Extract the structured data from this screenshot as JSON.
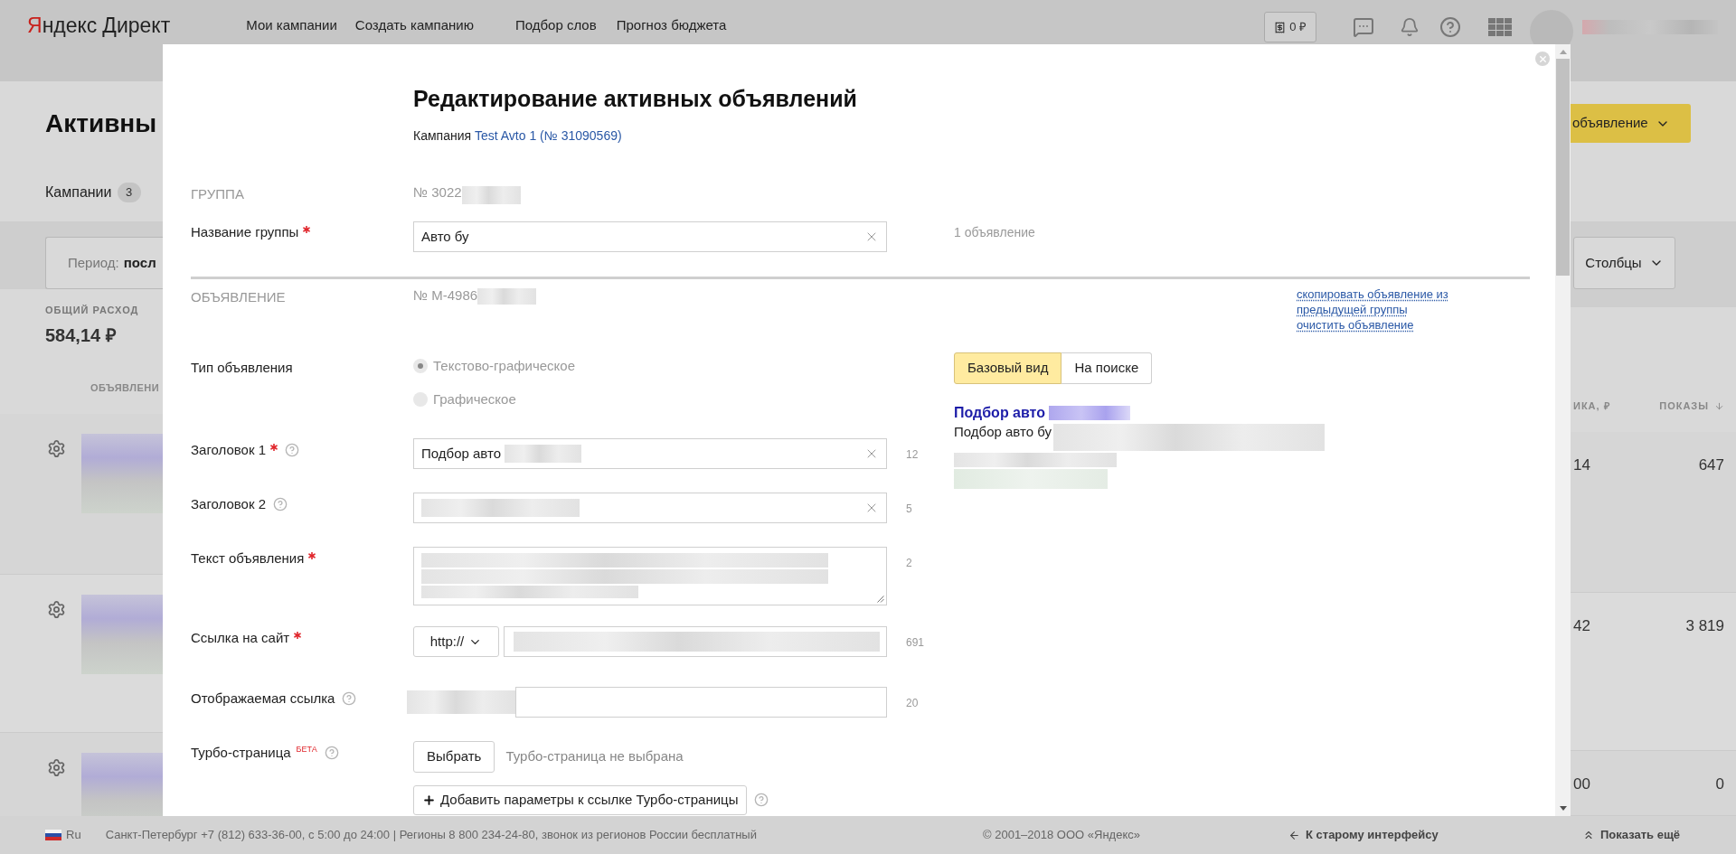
{
  "header": {
    "logo": {
      "brand": "Яндекс",
      "product": "Директ"
    },
    "nav": [
      {
        "label": "Мои кампании"
      },
      {
        "label": "Создать кампанию"
      },
      {
        "label": "Подбор слов"
      },
      {
        "label": "Прогноз бюджета"
      }
    ],
    "balance": "0 ₽",
    "user_redacted": true
  },
  "page": {
    "title": "Активны",
    "tab": {
      "label": "Кампании",
      "count": "3"
    },
    "period": {
      "label": "Период:",
      "value": "посл"
    },
    "total": {
      "label": "ОБЩИЙ РАСХОД",
      "value": "584,14 ₽"
    },
    "create_button": "объявление",
    "columns_button": "Столбцы",
    "table": {
      "columns": [
        {
          "label": "ОБЪЯВЛЕНИ",
          "sorted": false
        },
        {
          "label": "ИКА, ₽",
          "sorted": false
        },
        {
          "label": "ПОКАЗЫ",
          "sorted": true
        }
      ],
      "rows": [
        {
          "cost": "14",
          "shows": "647",
          "redacted": true
        },
        {
          "cost": "42",
          "shows": "3 819",
          "redacted": true
        },
        {
          "cost": "00",
          "shows": "0",
          "redacted": true
        }
      ]
    }
  },
  "modal": {
    "title": "Редактирование активных объявлений",
    "campaign_label": "Кампания",
    "campaign_link": "Test Avto 1 (№ 31090569)",
    "group": {
      "section": "ГРУППА",
      "number": "№ 3022",
      "number_redacted": true,
      "name_label": "Название группы",
      "name_required": true,
      "name_value": "Авто бу",
      "ads_count": "1 объявление"
    },
    "ad": {
      "section": "ОБЪЯВЛЕНИЕ",
      "number": "№ М-4986",
      "number_redacted": true,
      "links": [
        "скопировать объявление из предыдущей группы",
        "очистить объявление"
      ],
      "type_label": "Тип объявления",
      "types": [
        {
          "label": "Текстово-графическое",
          "selected": true,
          "disabled": true
        },
        {
          "label": "Графическое",
          "selected": false,
          "disabled": true
        }
      ],
      "fields": [
        {
          "kind": "input",
          "label": "Заголовок 1",
          "required": true,
          "help": true,
          "value": "Подбор авто",
          "redacted": true,
          "counter": "12"
        },
        {
          "kind": "input",
          "label": "Заголовок 2",
          "required": false,
          "help": true,
          "redacted": true,
          "counter": "5"
        },
        {
          "kind": "textarea",
          "label": "Текст объявления",
          "required": true,
          "help": false,
          "redacted": true,
          "counter": "2"
        },
        {
          "kind": "url",
          "label": "Ссылка на сайт",
          "required": true,
          "help": false,
          "protocol": "http://",
          "redacted": true,
          "counter": "691"
        },
        {
          "kind": "display_url",
          "label": "Отображаемая ссылка",
          "required": false,
          "help": true,
          "redacted": true,
          "counter": "20"
        }
      ],
      "turbo": {
        "label": "Турбо-страница",
        "badge": "БЕТА",
        "help": true,
        "button": "Выбрать",
        "status": "Турбо-страница не выбрана",
        "params_button": "Добавить параметры к ссылке Турбо-страницы",
        "params_help": true
      },
      "preview": {
        "modes": [
          {
            "label": "Базовый вид",
            "selected": true
          },
          {
            "label": "На поиске",
            "selected": false
          }
        ],
        "title": "Подбор авто",
        "text": "Подбор авто бу",
        "redacted": true
      }
    }
  },
  "footer": {
    "lang": "Ru",
    "contacts": "Санкт-Петербург +7 (812) 633-36-00, с 5:00 до 24:00 | Регионы 8 800 234-24-80, звонок из регионов России бесплатный",
    "copyright": "© 2001–2018 ООО «Яндекс»",
    "old_interface": "К старому интерфейсу",
    "show_more": "Показать ещё"
  }
}
